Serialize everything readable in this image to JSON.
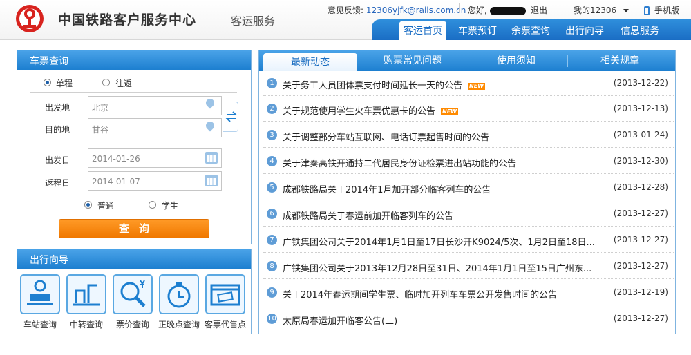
{
  "header": {
    "brand": "中国铁路客户服务中心",
    "subtitle": "客运服务",
    "feedback_label": "意见反馈:",
    "feedback_email": "12306yjfk@rails.com.cn",
    "greeting": "您好,",
    "logout": "退出",
    "my12306": "我的12306",
    "mobile": "手机版"
  },
  "nav": {
    "items": [
      "客运首页",
      "车票预订",
      "余票查询",
      "出行向导",
      "信息服务"
    ]
  },
  "ticket": {
    "title": "车票查询",
    "one_way": "单程",
    "round_trip": "往返",
    "from_label": "出发地",
    "from_value": "北京",
    "to_label": "目的地",
    "to_value": "甘谷",
    "depart_label": "出发日",
    "depart_value": "2014-01-26",
    "return_label": "返程日",
    "return_value": "2014-01-07",
    "normal": "普通",
    "student": "学生",
    "search": "查询"
  },
  "guide": {
    "title": "出行向导",
    "items": [
      "车站查询",
      "中转查询",
      "票价查询",
      "正晚点查询",
      "客票代售点"
    ]
  },
  "news": {
    "tabs": [
      "最新动态",
      "购票常见问题",
      "使用须知",
      "相关规章"
    ],
    "badge": "NEW",
    "rows": [
      {
        "num": "1",
        "title": "关于务工人员团体票支付时间延长一天的公告",
        "date": "(2013-12-22)"
      },
      {
        "num": "2",
        "title": "关于规范使用学生火车票优惠卡的公告",
        "date": "(2013-12-13)"
      },
      {
        "num": "3",
        "title": "关于调整部分车站互联网、电话订票起售时间的公告",
        "date": "(2013-01-24)"
      },
      {
        "num": "4",
        "title": "关于津秦高铁开通持二代居民身份证检票进出站功能的公告",
        "date": "(2013-12-30)"
      },
      {
        "num": "5",
        "title": "成都铁路局关于2014年1月加开部分临客列车的公告",
        "date": "(2013-12-28)"
      },
      {
        "num": "6",
        "title": "成都铁路局关于春运前加开临客列车的公告",
        "date": "(2013-12-27)"
      },
      {
        "num": "7",
        "title": "广铁集团公司关于2014年1月1日至17日长沙开K9024/5次、1月2日至18日...",
        "date": "(2013-12-27)"
      },
      {
        "num": "8",
        "title": "广铁集团公司关于2013年12月28日至31日、2014年1月1日至15日广州东...",
        "date": "(2013-12-27)"
      },
      {
        "num": "9",
        "title": "关于2014年春运期间学生票、临时加开列车车票公开发售时间的公告",
        "date": "(2013-12-19)"
      },
      {
        "num": "10",
        "title": "太原局春运加开临客公告(二)",
        "date": "(2013-12-27)"
      }
    ]
  }
}
